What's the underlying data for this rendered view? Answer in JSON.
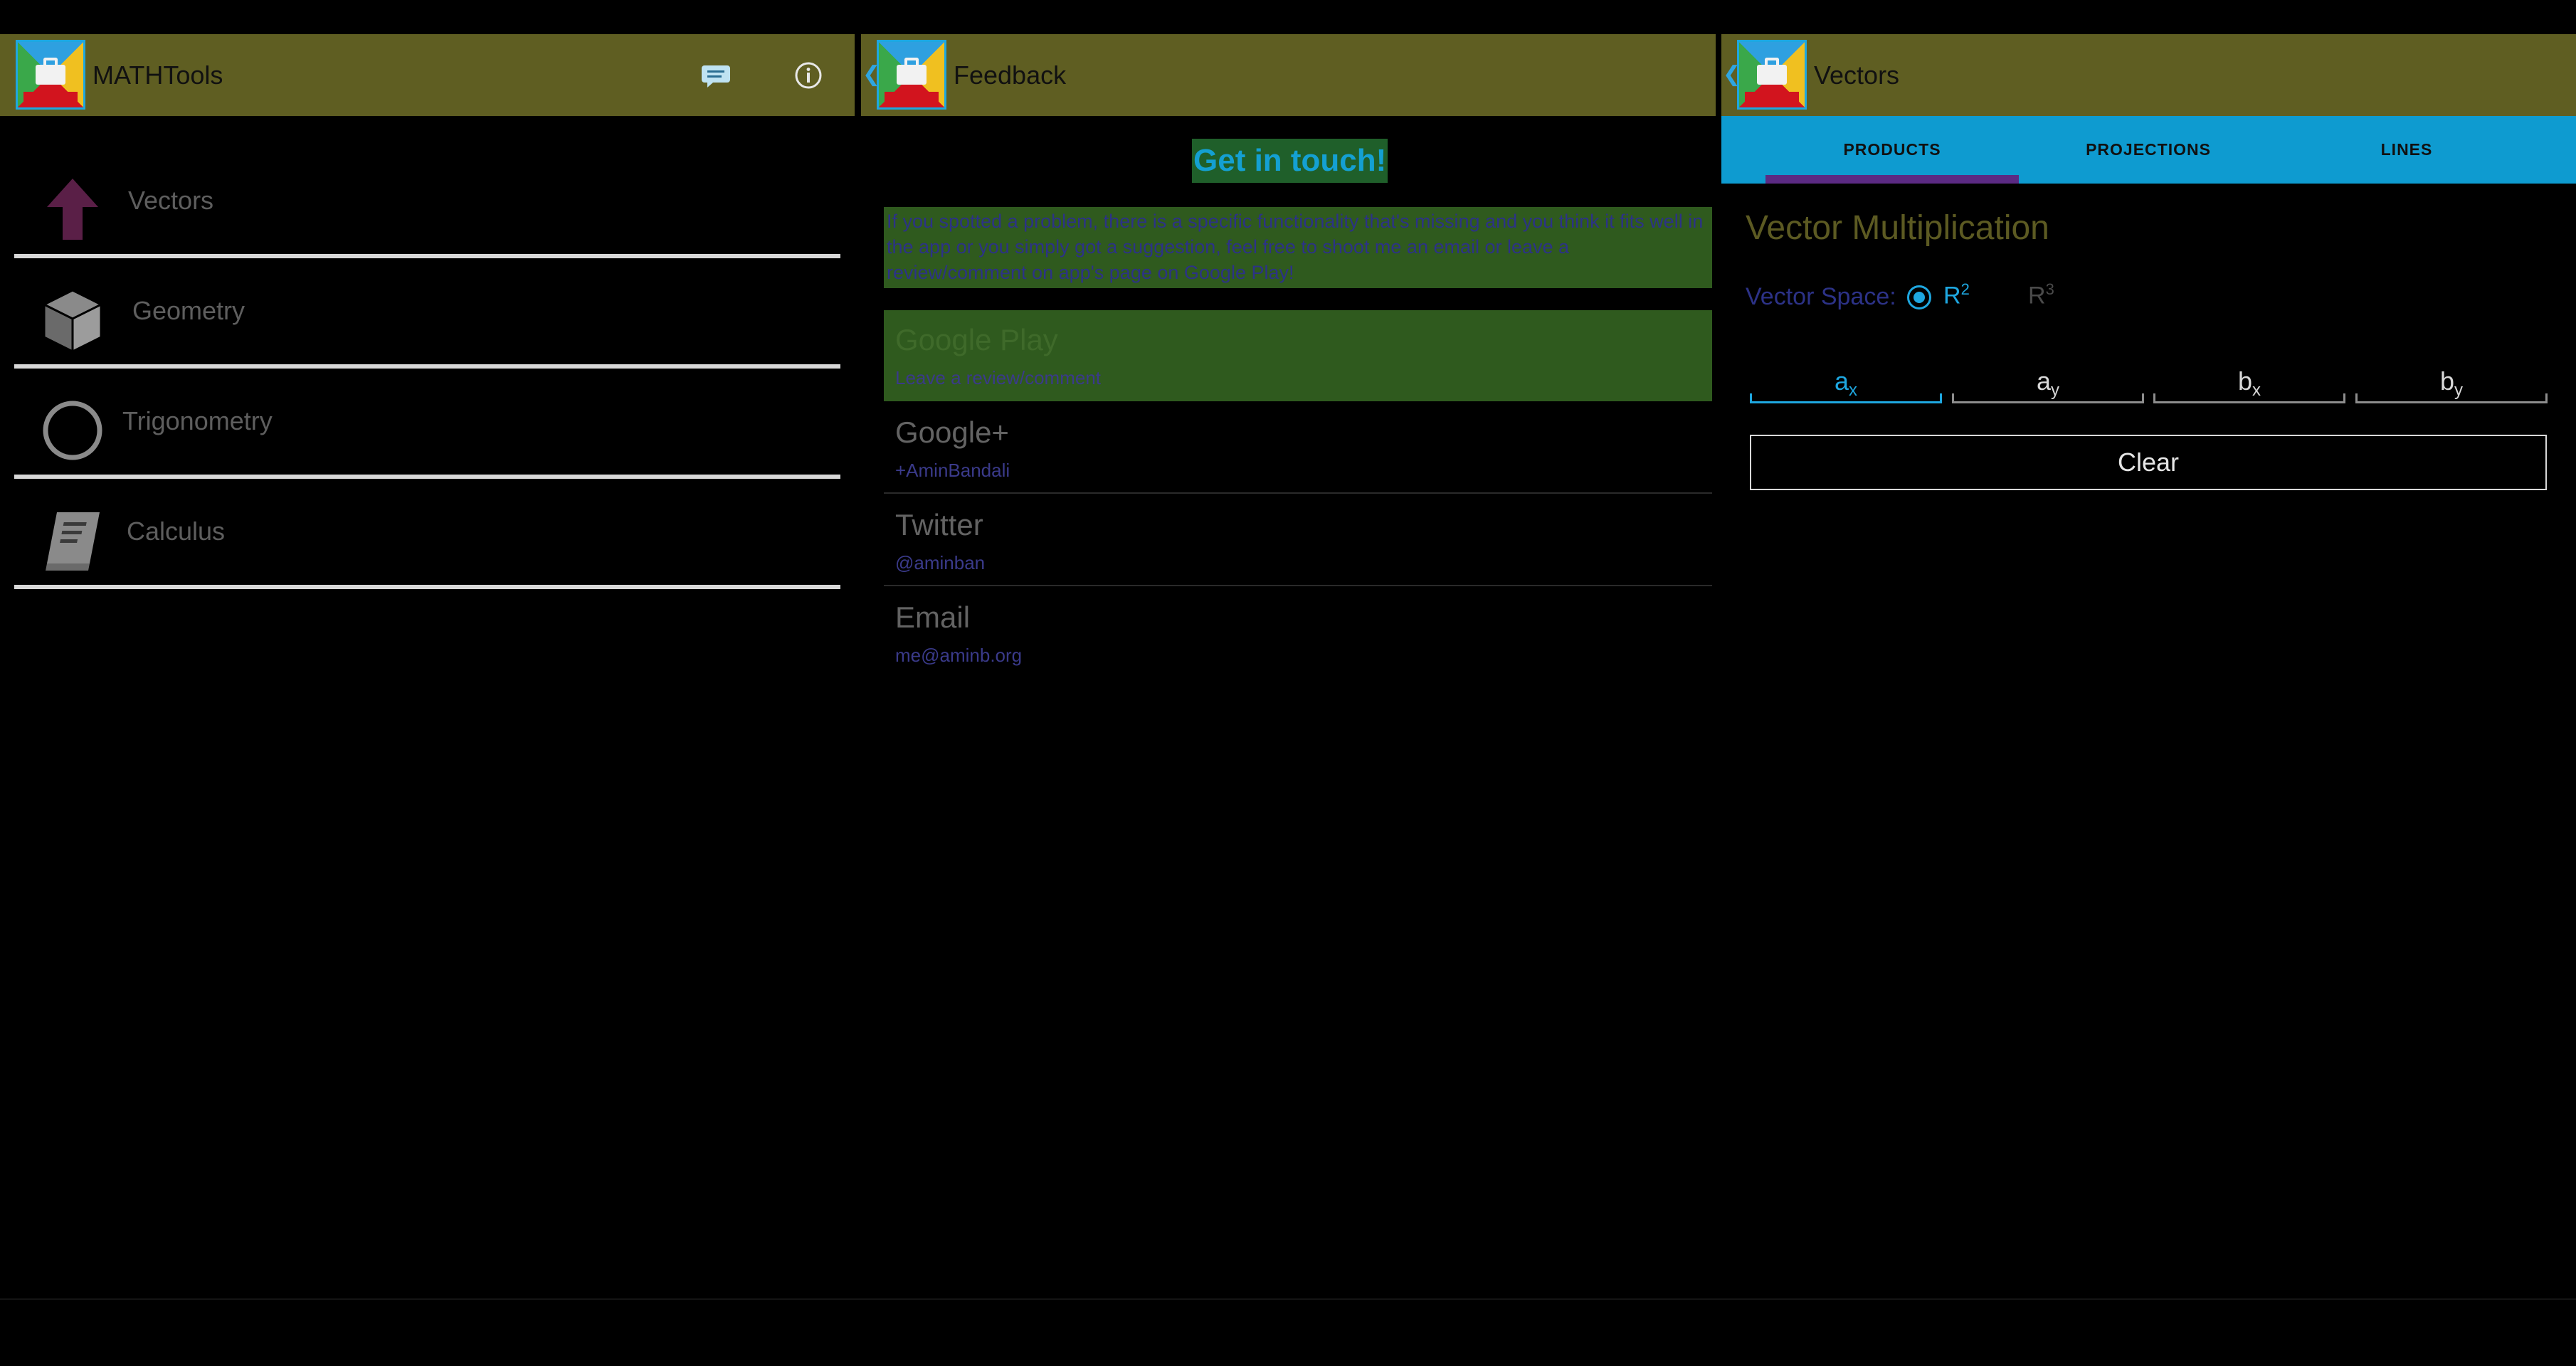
{
  "colors": {
    "actionbar": "#5f5e22",
    "accent_blue": "#1ea7e0",
    "tab_indicator": "#5b2a83",
    "feedback_highlight": "#2f5a1e",
    "background": "#000000"
  },
  "home": {
    "title": "MATHTools",
    "actions": [
      {
        "icon": "chat-bubble-icon"
      },
      {
        "icon": "info-icon"
      }
    ],
    "items": [
      {
        "label": "Vectors",
        "icon": "up-arrow-icon"
      },
      {
        "label": "Geometry",
        "icon": "cube-icon"
      },
      {
        "label": "Trigonometry",
        "icon": "circle-icon"
      },
      {
        "label": "Calculus",
        "icon": "book-icon"
      }
    ]
  },
  "feedback": {
    "title": "Feedback",
    "heading": "Get in touch!",
    "intro": "If you spotted a problem, there is a specific functionality that's missing and you think it fits well in the app or you simply got a suggestion, feel free to shoot me an email or leave a review/comment on app's page on Google Play!",
    "rows": [
      {
        "title": "Google Play",
        "subtitle": "Leave a review/comment"
      },
      {
        "title": "Google+",
        "subtitle": "+AminBandali"
      },
      {
        "title": "Twitter",
        "subtitle": "@aminban"
      },
      {
        "title": "Email",
        "subtitle": "me@aminb.org"
      }
    ]
  },
  "vectors": {
    "title": "Vectors",
    "tabs": [
      {
        "label": "PRODUCTS",
        "selected": true
      },
      {
        "label": "PROJECTIONS",
        "selected": false
      },
      {
        "label": "LINES",
        "selected": false
      }
    ],
    "section_title": "Vector Multiplication",
    "vector_space_label": "Vector Space:",
    "options": [
      {
        "base": "R",
        "exp": "2",
        "selected": true
      },
      {
        "base": "R",
        "exp": "3",
        "selected": false
      }
    ],
    "inputs": [
      {
        "base": "a",
        "sub": "x"
      },
      {
        "base": "a",
        "sub": "y"
      },
      {
        "base": "b",
        "sub": "x"
      },
      {
        "base": "b",
        "sub": "y"
      }
    ],
    "clear_label": "Clear"
  }
}
